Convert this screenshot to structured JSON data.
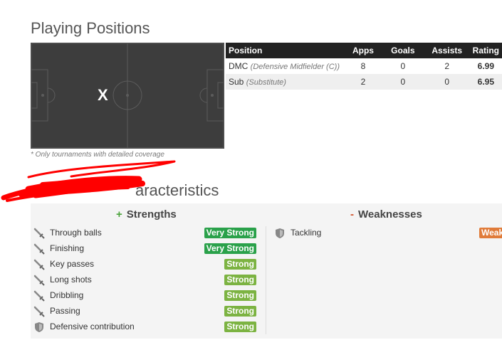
{
  "positions": {
    "title": "Playing Positions",
    "note": "* Only tournaments with detailed coverage",
    "pitch_marker": "X",
    "columns": {
      "position": "Position",
      "apps": "Apps",
      "goals": "Goals",
      "assists": "Assists",
      "rating": "Rating"
    },
    "rows": [
      {
        "code": "DMC",
        "detail": "(Defensive Midfielder (C))",
        "apps": "8",
        "goals": "0",
        "assists": "2",
        "rating": "6.99"
      },
      {
        "code": "Sub",
        "detail": "(Substitute)",
        "apps": "2",
        "goals": "0",
        "assists": "0",
        "rating": "6.95"
      }
    ]
  },
  "characteristics": {
    "title_visible": "aracteristics",
    "strengths": {
      "sign": "+",
      "title": "Strengths",
      "items": [
        {
          "name": "Through balls",
          "level": "Very Strong",
          "icon": "sword-icon"
        },
        {
          "name": "Finishing",
          "level": "Very Strong",
          "icon": "sword-icon"
        },
        {
          "name": "Key passes",
          "level": "Strong",
          "icon": "sword-icon"
        },
        {
          "name": "Long shots",
          "level": "Strong",
          "icon": "sword-icon"
        },
        {
          "name": "Dribbling",
          "level": "Strong",
          "icon": "sword-icon"
        },
        {
          "name": "Passing",
          "level": "Strong",
          "icon": "sword-icon"
        },
        {
          "name": "Defensive contribution",
          "level": "Strong",
          "icon": "shield-icon"
        }
      ]
    },
    "weaknesses": {
      "sign": "-",
      "title": "Weaknesses",
      "items": [
        {
          "name": "Tackling",
          "level": "Weak",
          "icon": "shield-icon"
        }
      ]
    }
  },
  "colors": {
    "pitch": "#3d3d3d",
    "table_header": "#222222",
    "rating": "#e0612a",
    "very_strong": "#2aa14a",
    "strong": "#7cb342",
    "weak": "#e07b39",
    "redaction": "#ff0000"
  }
}
